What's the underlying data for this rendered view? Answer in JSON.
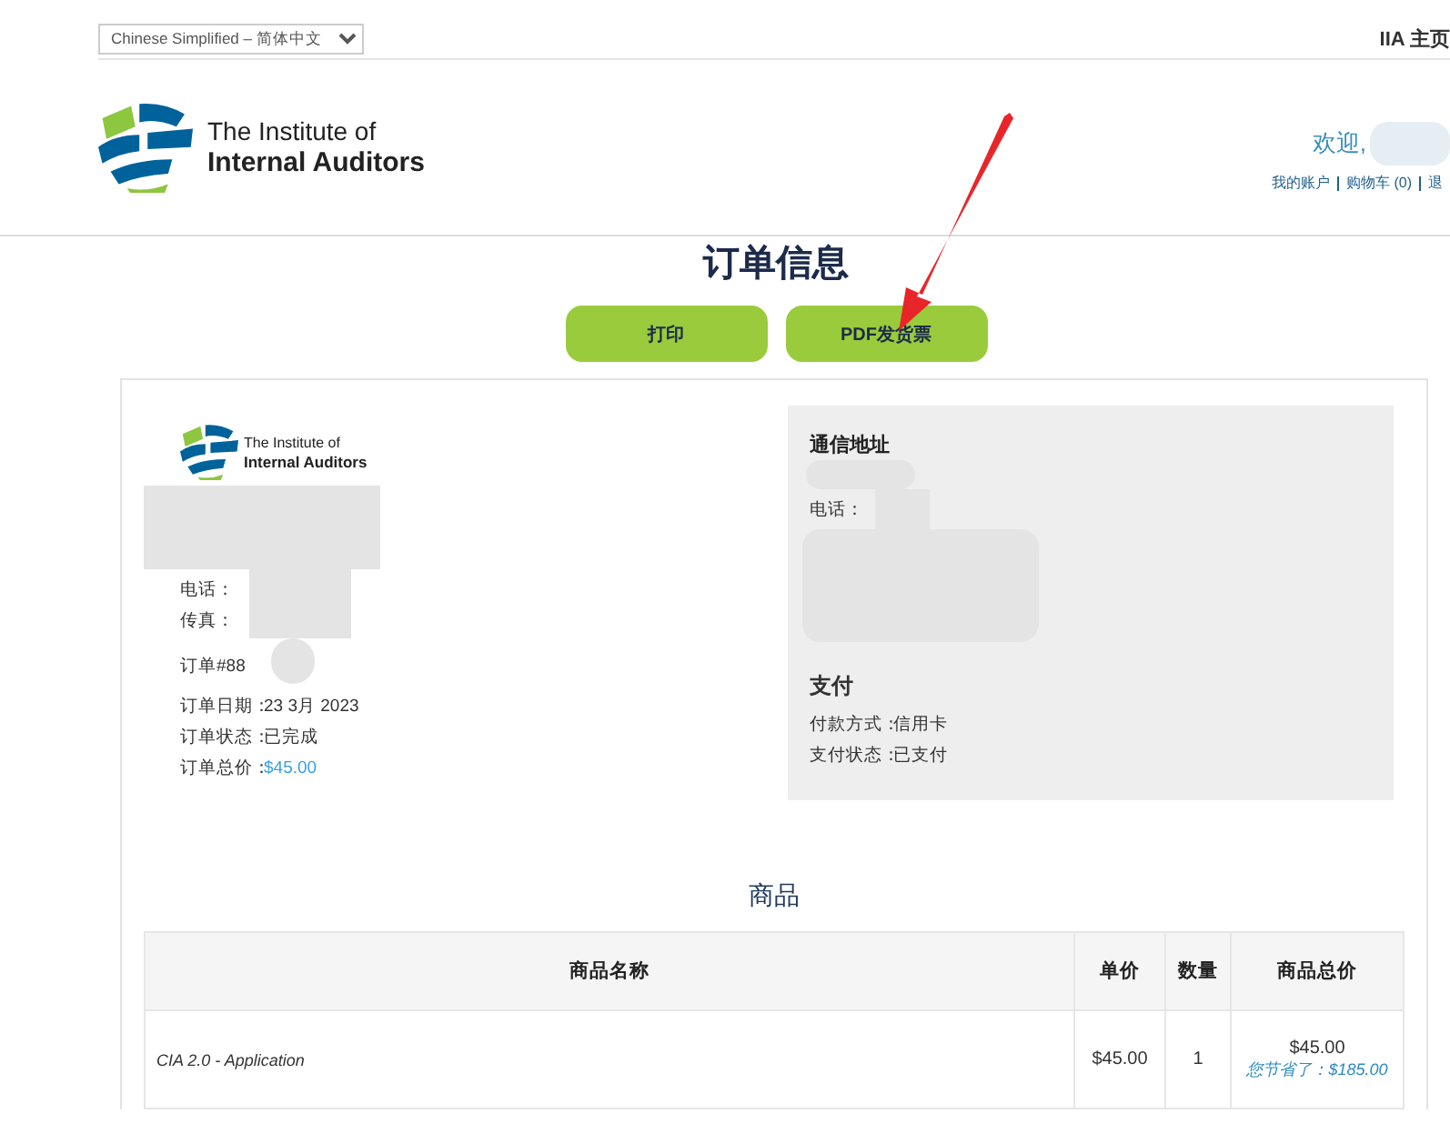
{
  "language_select": {
    "value": "Chinese Simplified – 简体中文"
  },
  "top_link": "IIA 主页",
  "logo": {
    "line1": "The Institute of",
    "line2": "Internal Auditors"
  },
  "welcome": "欢迎,",
  "account_links": [
    "我的账户",
    "购物车 (0)",
    "退"
  ],
  "page_title": "订单信息",
  "buttons": [
    "打印",
    "PDF发货票"
  ],
  "seller": {
    "logo": {
      "line1": "The Institute of",
      "line2": "Internal Auditors"
    },
    "contact_labels": [
      "电话：",
      "传真："
    ]
  },
  "order": {
    "number": "订单#88",
    "details": [
      {
        "label": "订单日期：",
        "value": "23 3月 2023",
        "kind": "text"
      },
      {
        "label": "订单状态：",
        "value": "已完成",
        "kind": "text"
      },
      {
        "label": "订单总价：",
        "value": "$45.00",
        "kind": "price"
      }
    ]
  },
  "shipping": {
    "heading": "通信地址",
    "phone_label": "电话："
  },
  "payment": {
    "heading": "支付",
    "details": [
      {
        "label": "付款方式：",
        "value": "信用卡"
      },
      {
        "label": "支付状态：",
        "value": "已支付"
      }
    ]
  },
  "items": {
    "heading": "商品",
    "columns": [
      "商品名称",
      "单价",
      "数量",
      "商品总价"
    ],
    "rows": [
      {
        "name": "CIA 2.0 - Application",
        "unit_price": "$45.00",
        "quantity": "1",
        "total": "$45.00",
        "savings": "您节省了：$185.00"
      }
    ]
  }
}
